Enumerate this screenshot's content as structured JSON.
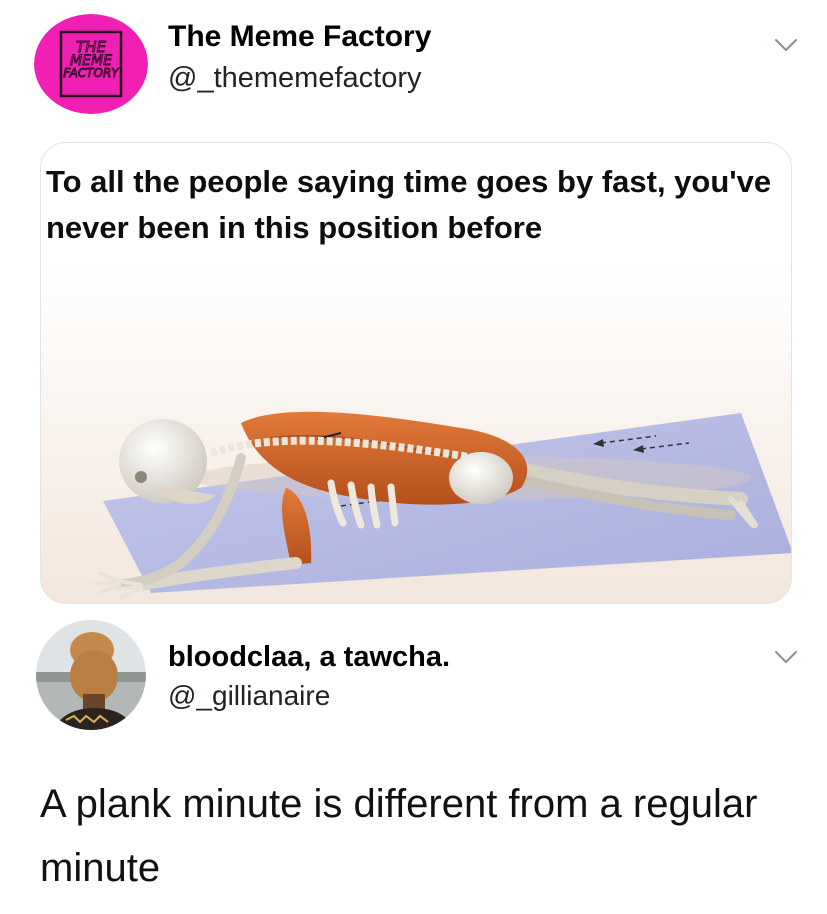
{
  "tweet": {
    "author": {
      "display_name": "The Meme Factory",
      "handle": "@_thememefactory",
      "avatar": {
        "logo_text": [
          "THE",
          "MEME",
          "FACTORY"
        ],
        "background_color": "#f21fb4",
        "icon": "brand-logo-avatar"
      }
    },
    "more_icon": "chevron-down-icon",
    "quote": {
      "text": "To all the people saying time goes by fast, you've never been in this position before",
      "image": {
        "description_icon": "plank-skeleton-illustration"
      }
    }
  },
  "reply": {
    "author": {
      "display_name": "bloodclaa, a tawcha.",
      "handle": "@_gillianaire",
      "avatar": {
        "icon": "user-avatar-photo"
      }
    },
    "more_icon": "chevron-down-icon",
    "body": "A plank minute is different from a regular minute"
  },
  "colors": {
    "brand_pink": "#f21fb4",
    "mat_blue": "#b8bde6",
    "muscle_orange": "#d0652a"
  }
}
